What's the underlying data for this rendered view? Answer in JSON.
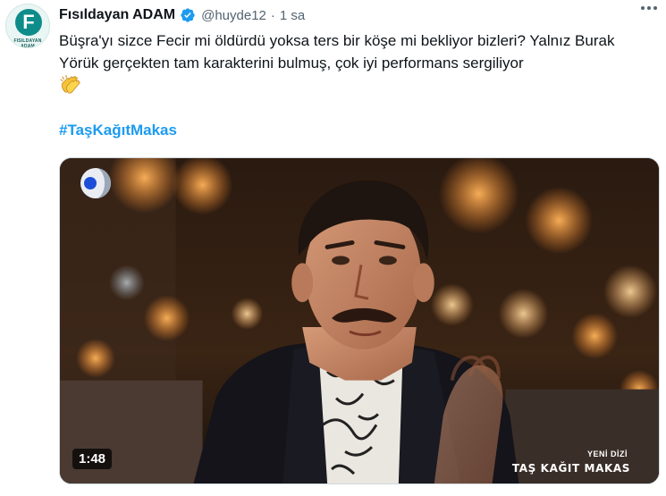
{
  "tweet": {
    "author_name": "Fısıldayan ADAM",
    "handle": "@huyde12",
    "separator": "·",
    "time": "1 sa",
    "text": "Büşra'yı sizce Fecir mi öldürdü yoksa ters bir köşe mi bekliyor bizleri? Yalnız Burak Yörük gerçekten tam karakterini bulmuş, çok iyi performans sergiliyor",
    "emoji_icon": "clapping-hands-icon",
    "hashtag": "#TaşKağıtMakas"
  },
  "avatar": {
    "letter": "F",
    "caption": "FISILDAYAN ADAM"
  },
  "video": {
    "duration": "1:48",
    "badge_small": "YENİ DİZİ",
    "badge_title": "TAŞ KAĞIT MAKAS",
    "channel_logo": "kanal-d-logo"
  },
  "colors": {
    "link": "#1d9bf0",
    "verified": "#1d9bf0",
    "muted": "#536471"
  }
}
